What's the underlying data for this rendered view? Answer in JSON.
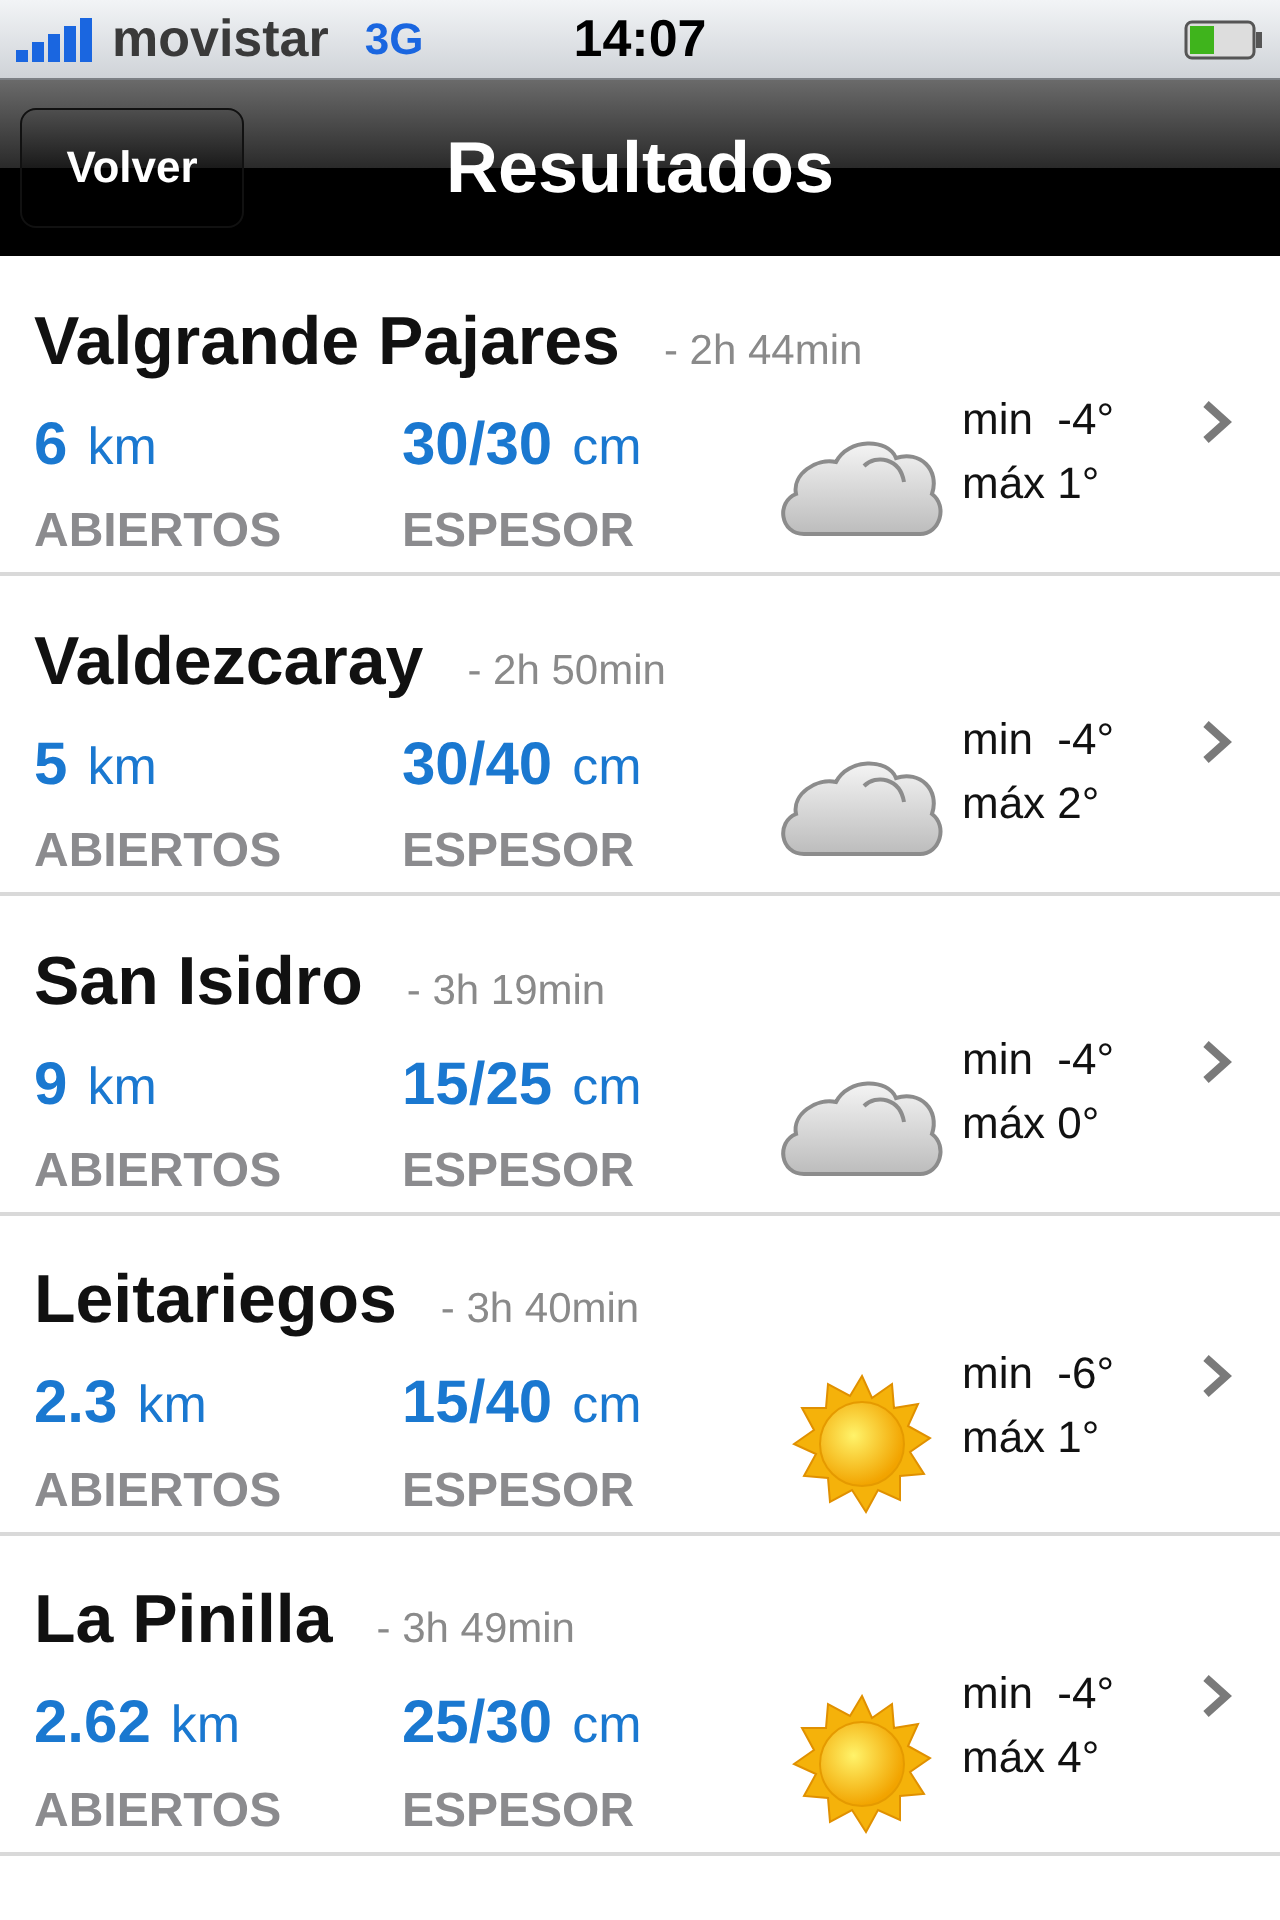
{
  "status_bar": {
    "carrier": "movistar",
    "network": "3G",
    "time": "14:07"
  },
  "nav_bar": {
    "back_button": "Volver",
    "title": "Resultados"
  },
  "results": [
    {
      "name": "Valgrande Pajares",
      "time": "- 2h 44min",
      "km": "6",
      "km_unit": "km",
      "km_label": "ABIERTOS",
      "snow": "30/30",
      "snow_unit": "cm",
      "snow_label": "ESPESOR",
      "kind": "cloud",
      "min": "min  -4°",
      "max": "máx 1°"
    },
    {
      "name": "Valdezcaray",
      "time": "- 2h 50min",
      "km": "5",
      "km_unit": "km",
      "km_label": "ABIERTOS",
      "snow": "30/40",
      "snow_unit": "cm",
      "snow_label": "ESPESOR",
      "kind": "cloud",
      "min": "min  -4°",
      "max": "máx 2°"
    },
    {
      "name": "San Isidro",
      "time": "- 3h 19min",
      "km": "9",
      "km_unit": "km",
      "km_label": "ABIERTOS",
      "snow": "15/25",
      "snow_unit": "cm",
      "snow_label": "ESPESOR",
      "kind": "cloud",
      "min": "min  -4°",
      "max": "máx 0°"
    },
    {
      "name": "Leitariegos",
      "time": "- 3h 40min",
      "km": "2.3",
      "km_unit": "km",
      "km_label": "ABIERTOS",
      "snow": "15/40",
      "snow_unit": "cm",
      "snow_label": "ESPESOR",
      "kind": "sun",
      "min": "min  -6°",
      "max": "máx 1°"
    },
    {
      "name": "La Pinilla",
      "time": "- 3h 49min",
      "km": "2.62",
      "km_unit": "km",
      "km_label": "ABIERTOS",
      "snow": "25/30",
      "snow_unit": "cm",
      "snow_label": "ESPESOR",
      "kind": "sun",
      "min": "min  -4°",
      "max": "máx 4°"
    }
  ]
}
